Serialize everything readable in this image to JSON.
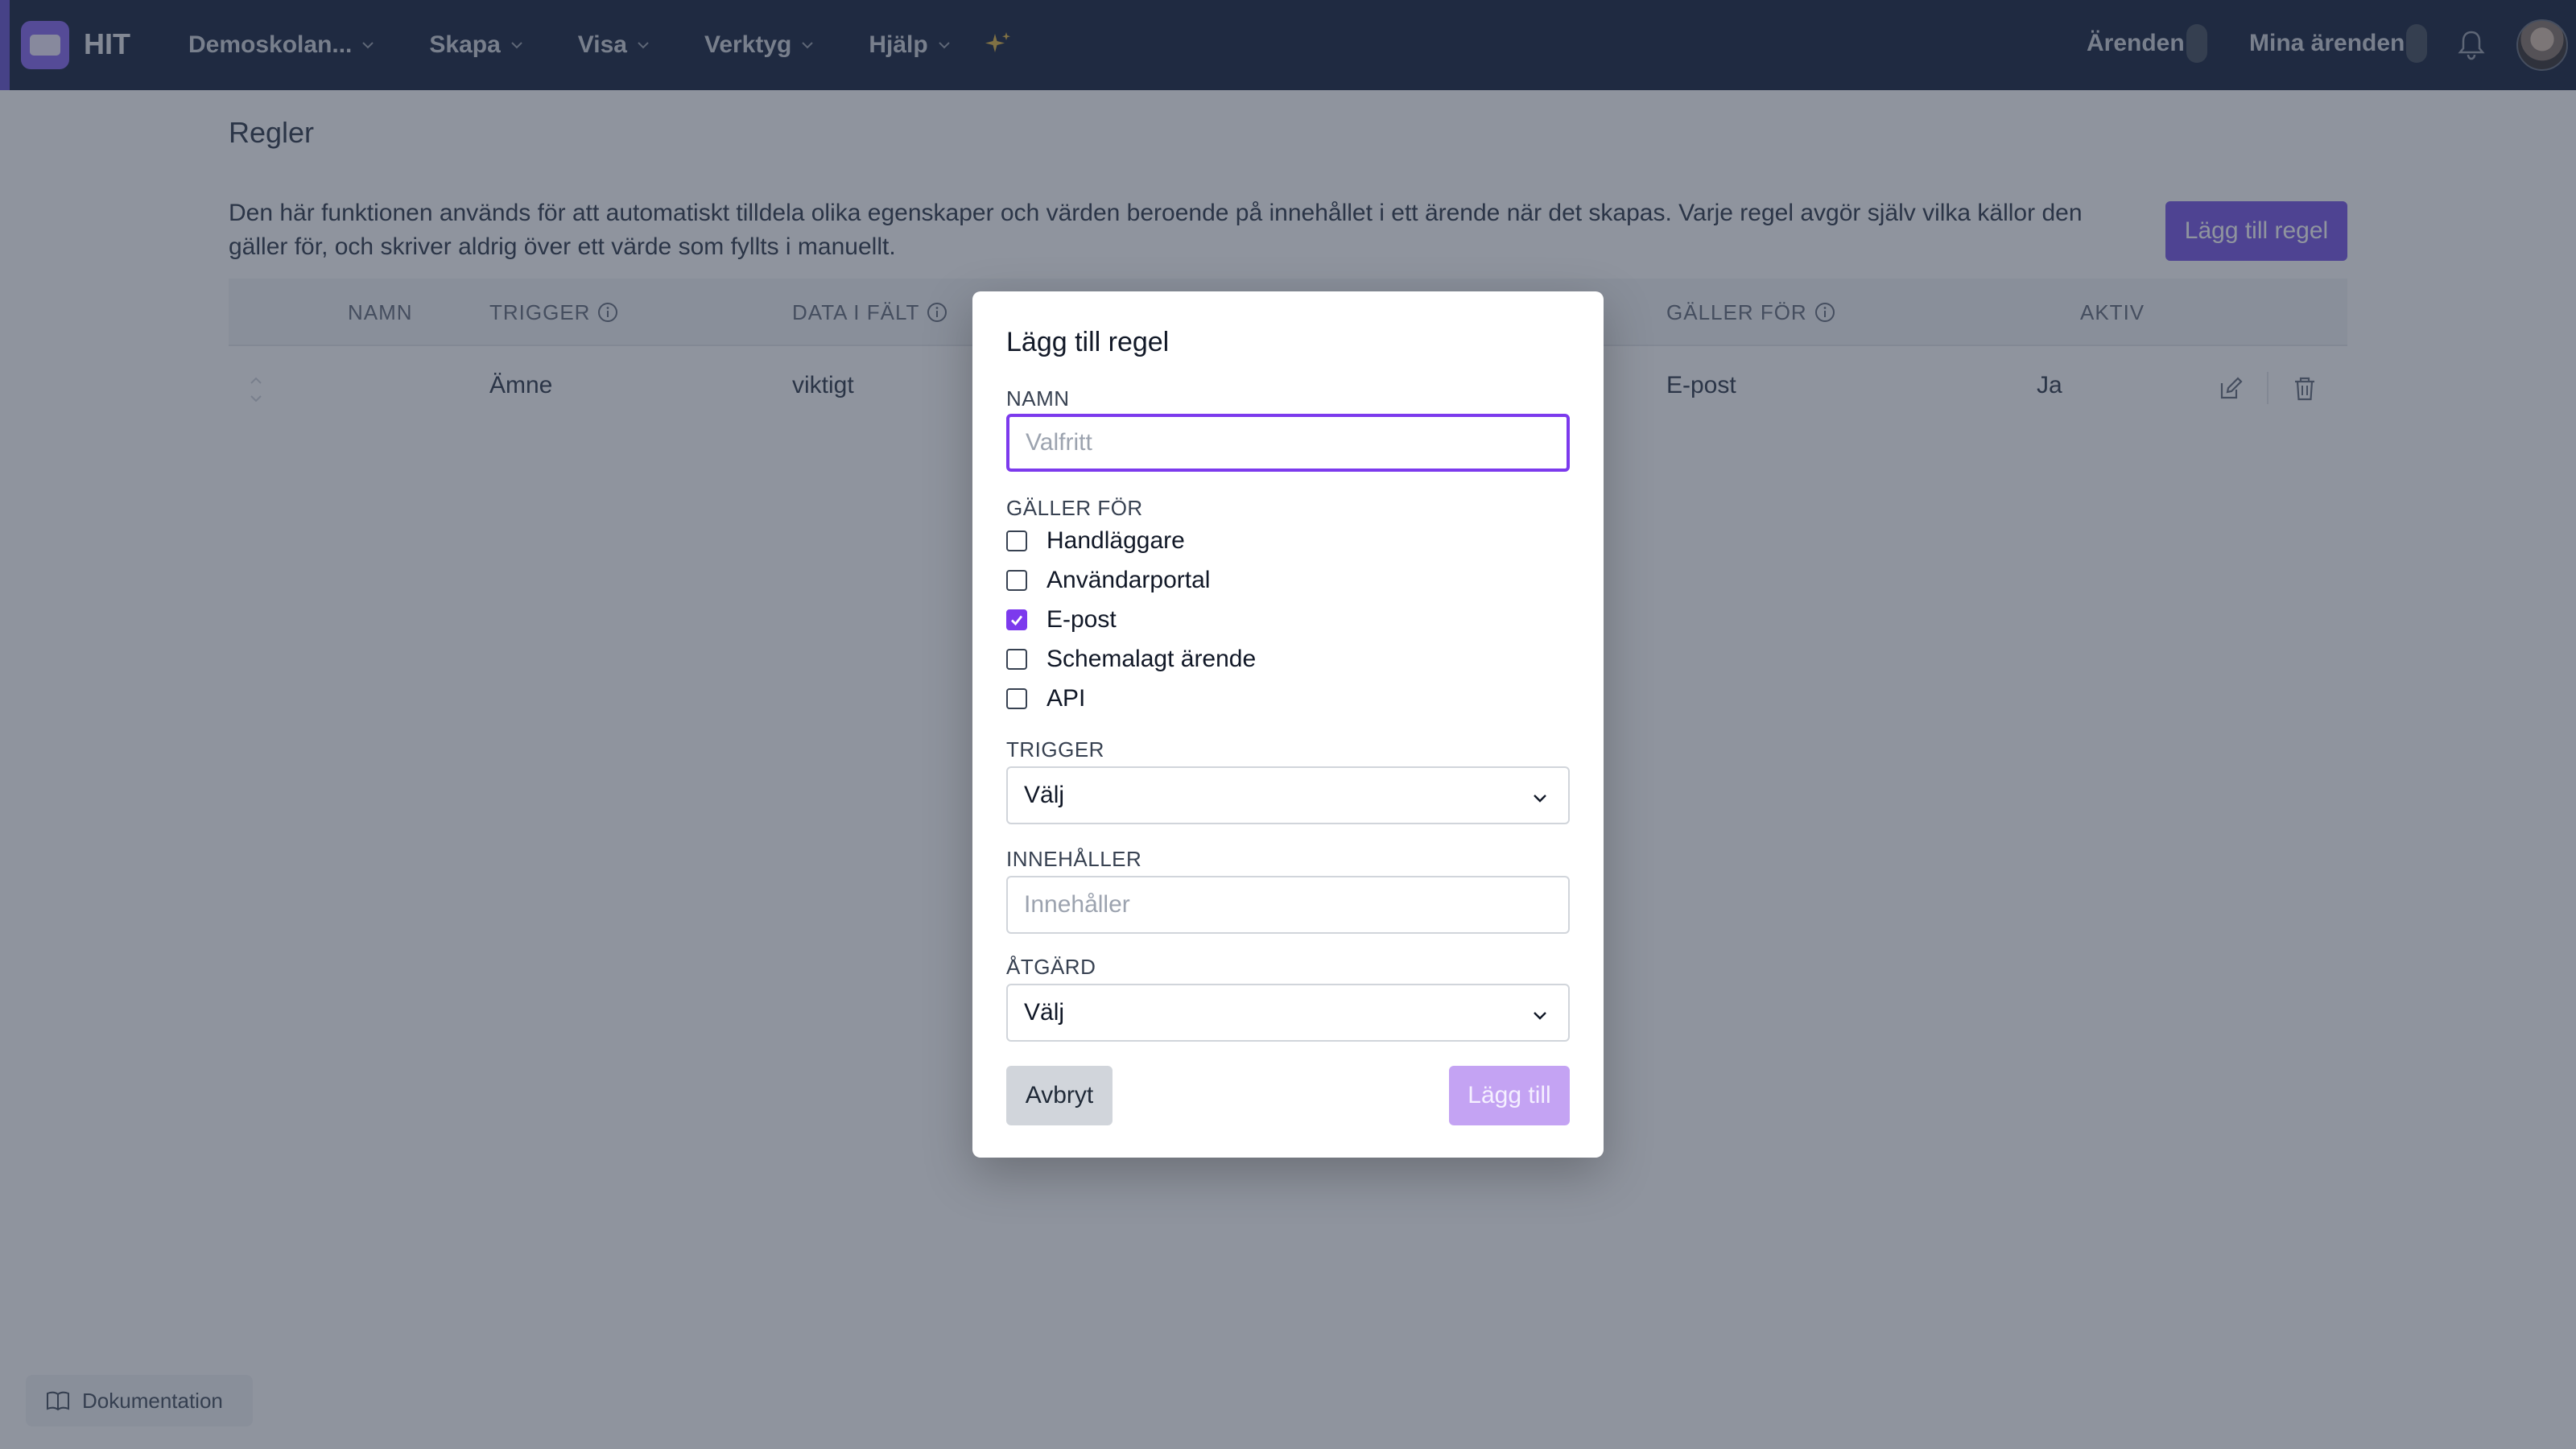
{
  "app": {
    "brand": "HIT"
  },
  "nav": {
    "items": [
      {
        "label": "Demoskolan..."
      },
      {
        "label": "Skapa"
      },
      {
        "label": "Visa"
      },
      {
        "label": "Verktyg"
      },
      {
        "label": "Hjälp"
      }
    ],
    "arenden_label": "Ärenden",
    "mina_arenden_label": "Mina ärenden"
  },
  "page": {
    "title": "Regler",
    "description": "Den här funktionen används för att automatiskt tilldela olika egenskaper och värden beroende på innehållet i ett ärende när det skapas. Varje regel avgör själv vilka källor den gäller för, och skriver aldrig över ett värde som fyllts i manuellt.",
    "add_button": "Lägg till regel"
  },
  "table": {
    "columns": [
      "NAMN",
      "TRIGGER",
      "DATA I FÄLT",
      "GÄLLER FÖR",
      "AKTIV"
    ],
    "rows": [
      {
        "namn": "",
        "trigger": "Ämne",
        "data": "viktigt",
        "galler_for": "E-post",
        "aktiv": "Ja"
      }
    ]
  },
  "footer": {
    "doc_label": "Dokumentation"
  },
  "modal": {
    "title": "Lägg till regel",
    "name_label": "NAMN",
    "name_placeholder": "Valfritt",
    "applies_label": "GÄLLER FÖR",
    "applies_options": [
      {
        "label": "Handläggare",
        "checked": false
      },
      {
        "label": "Användarportal",
        "checked": false
      },
      {
        "label": "E-post",
        "checked": true
      },
      {
        "label": "Schemalagt ärende",
        "checked": false
      },
      {
        "label": "API",
        "checked": false
      }
    ],
    "trigger_label": "TRIGGER",
    "trigger_value": "Välj",
    "contains_label": "INNEHÅLLER",
    "contains_placeholder": "Innehåller",
    "action_label": "ÅTGÄRD",
    "action_value": "Välj",
    "cancel_label": "Avbryt",
    "submit_label": "Lägg till"
  },
  "colors": {
    "accent": "#7c3aed",
    "topbar": "#1e2a44",
    "primary_button": "#7c5ce6",
    "disabled_button": "#c4a3f3"
  }
}
